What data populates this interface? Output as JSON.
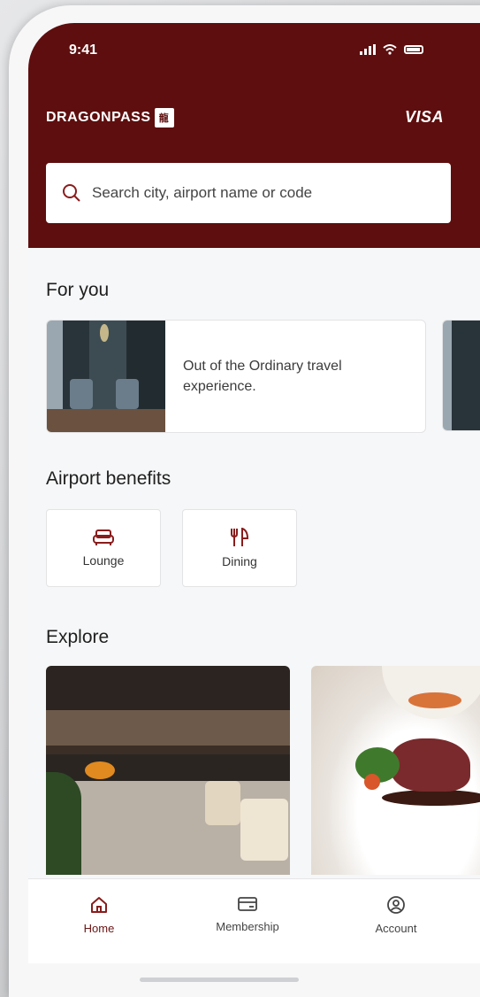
{
  "status_bar": {
    "time": "9:41"
  },
  "header": {
    "brand": "DRAGONPASS",
    "brand_mark": "龍",
    "partner": "VISA"
  },
  "search": {
    "placeholder": "Search city, airport name or code"
  },
  "for_you": {
    "title": "For you",
    "card_text": "Out of the Ordinary travel experience."
  },
  "airport_benefits": {
    "title": "Airport benefits",
    "items": [
      {
        "label": "Lounge",
        "icon": "sofa-icon"
      },
      {
        "label": "Dining",
        "icon": "fork-knife-icon"
      }
    ]
  },
  "explore": {
    "title": "Explore"
  },
  "tabs": [
    {
      "label": "Home",
      "icon": "home-icon",
      "active": true
    },
    {
      "label": "Membership",
      "icon": "card-icon",
      "active": false
    },
    {
      "label": "Account",
      "icon": "user-icon",
      "active": false
    }
  ],
  "colors": {
    "brand": "#5e0e0e",
    "accent": "#8a1c1c"
  }
}
